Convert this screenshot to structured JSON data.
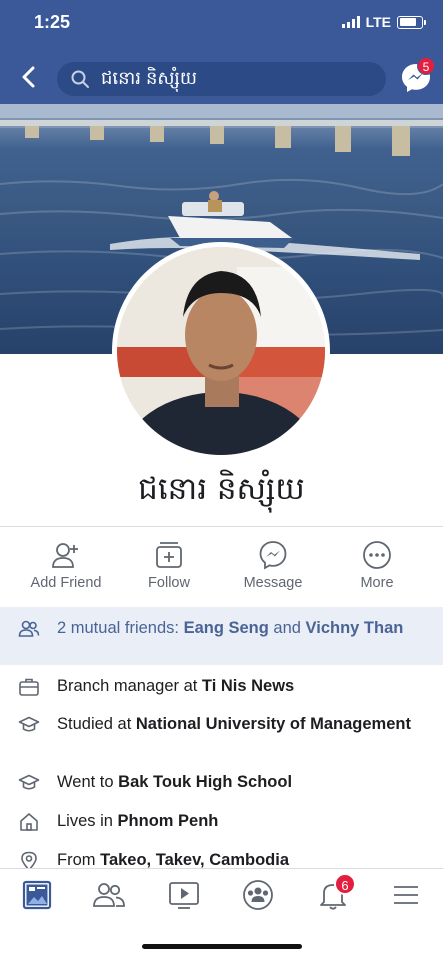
{
  "status_bar": {
    "time": "1:25",
    "network": "LTE"
  },
  "header": {
    "search_query": "ជនោ​រ និស្សុំយ",
    "messenger_badge": "5"
  },
  "profile": {
    "name": "ជនោ​រ និស្សុំយ"
  },
  "actions": [
    {
      "label": "Add Friend",
      "icon": "add-friend-icon"
    },
    {
      "label": "Follow",
      "icon": "follow-icon"
    },
    {
      "label": "Message",
      "icon": "messenger-icon"
    },
    {
      "label": "More",
      "icon": "more-icon"
    }
  ],
  "mutual": {
    "prefix": "2 mutual friends: ",
    "friend1": "Eang Seng",
    "joiner": " and ",
    "friend2": "Vichny Than"
  },
  "info": {
    "work": {
      "prefix": "Branch manager at ",
      "value": "Ti Nis News",
      "icon": "briefcase-icon"
    },
    "college": {
      "prefix": "Studied at ",
      "value": "National University of Management",
      "icon": "graduation-cap-icon"
    },
    "highschool": {
      "prefix": "Went to ",
      "value": "Bak Touk High School",
      "icon": "graduation-cap-icon"
    },
    "lives": {
      "prefix": "Lives in ",
      "value": "Phnom Penh",
      "icon": "home-icon"
    },
    "from": {
      "prefix": "From ",
      "value": "Takeo, Takev, Cambodia",
      "icon": "location-pin-icon"
    }
  },
  "tab_bar": {
    "notifications_badge": "6",
    "tabs": [
      "news-feed-icon",
      "friends-icon",
      "watch-icon",
      "groups-icon",
      "notifications-icon",
      "menu-icon"
    ]
  },
  "colors": {
    "brand": "#3b5998",
    "link": "#4b6496",
    "badge": "#e41e3f"
  }
}
